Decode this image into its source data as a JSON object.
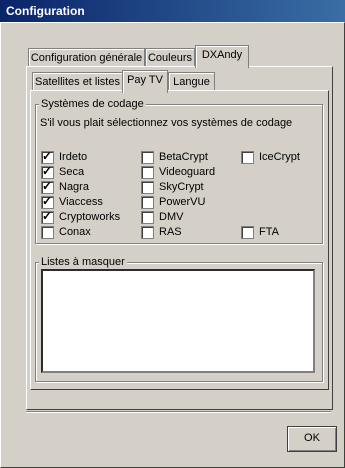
{
  "window": {
    "title": "Configuration"
  },
  "outer_tabs": [
    {
      "label": "Configuration générale",
      "active": false
    },
    {
      "label": "Couleurs",
      "active": false
    },
    {
      "label": "DXAndy",
      "active": true
    }
  ],
  "inner_tabs": [
    {
      "label": "Satellites et listes",
      "active": false
    },
    {
      "label": "Pay TV",
      "active": true
    },
    {
      "label": "Langue",
      "active": false
    }
  ],
  "encoding_group": {
    "title": "Systèmes de codage",
    "instruction": "S'il vous plait sélectionnez vos systèmes de codage",
    "options": [
      {
        "label": "Irdeto",
        "checked": true
      },
      {
        "label": "Seca",
        "checked": true
      },
      {
        "label": "Nagra",
        "checked": true
      },
      {
        "label": "Viaccess",
        "checked": true
      },
      {
        "label": "Cryptoworks",
        "checked": true
      },
      {
        "label": "Conax",
        "checked": false
      },
      {
        "label": "BetaCrypt",
        "checked": false
      },
      {
        "label": "Videoguard",
        "checked": false
      },
      {
        "label": "SkyCrypt",
        "checked": false
      },
      {
        "label": "PowerVU",
        "checked": false
      },
      {
        "label": "DMV",
        "checked": false
      },
      {
        "label": "RAS",
        "checked": false
      },
      {
        "label": "IceCrypt",
        "checked": false
      },
      {
        "label": "FTA",
        "checked": false
      }
    ]
  },
  "hidden_lists_group": {
    "title": "Listes à masquer",
    "items": []
  },
  "buttons": {
    "ok": "OK"
  }
}
